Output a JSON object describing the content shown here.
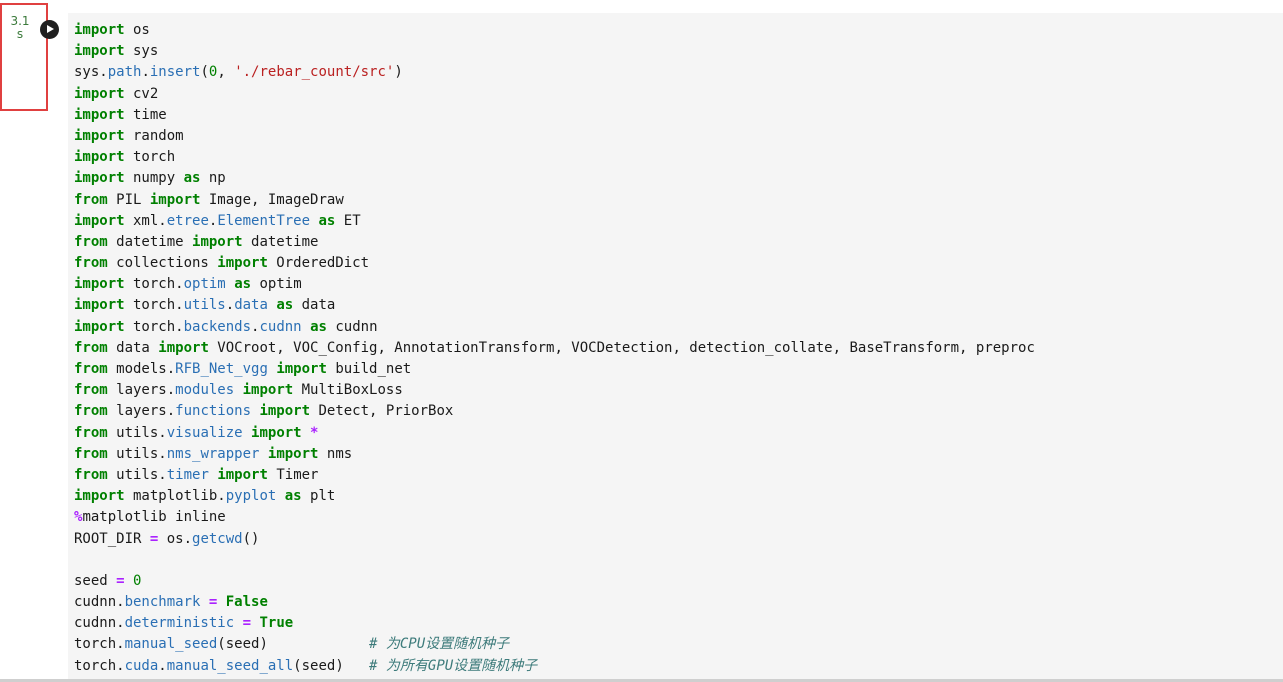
{
  "execution": {
    "time_label": "3.1 s"
  },
  "cell": {
    "lines": [
      [
        {
          "t": "import",
          "c": "kw"
        },
        {
          "t": " os",
          "c": ""
        }
      ],
      [
        {
          "t": "import",
          "c": "kw"
        },
        {
          "t": " sys",
          "c": ""
        }
      ],
      [
        {
          "t": "sys.",
          "c": ""
        },
        {
          "t": "path",
          "c": "attr"
        },
        {
          "t": ".",
          "c": ""
        },
        {
          "t": "insert",
          "c": "attr"
        },
        {
          "t": "(",
          "c": ""
        },
        {
          "t": "0",
          "c": "num"
        },
        {
          "t": ", ",
          "c": ""
        },
        {
          "t": "'./rebar_count/src'",
          "c": "str"
        },
        {
          "t": ")",
          "c": ""
        }
      ],
      [
        {
          "t": "import",
          "c": "kw"
        },
        {
          "t": " cv2",
          "c": ""
        }
      ],
      [
        {
          "t": "import",
          "c": "kw"
        },
        {
          "t": " time",
          "c": ""
        }
      ],
      [
        {
          "t": "import",
          "c": "kw"
        },
        {
          "t": " random",
          "c": ""
        }
      ],
      [
        {
          "t": "import",
          "c": "kw"
        },
        {
          "t": " torch",
          "c": ""
        }
      ],
      [
        {
          "t": "import",
          "c": "kw"
        },
        {
          "t": " numpy ",
          "c": ""
        },
        {
          "t": "as",
          "c": "kw"
        },
        {
          "t": " np",
          "c": ""
        }
      ],
      [
        {
          "t": "from",
          "c": "kw"
        },
        {
          "t": " PIL ",
          "c": ""
        },
        {
          "t": "import",
          "c": "kw"
        },
        {
          "t": " Image, ImageDraw",
          "c": ""
        }
      ],
      [
        {
          "t": "import",
          "c": "kw"
        },
        {
          "t": " xml.",
          "c": ""
        },
        {
          "t": "etree",
          "c": "attr"
        },
        {
          "t": ".",
          "c": ""
        },
        {
          "t": "ElementTree",
          "c": "attr"
        },
        {
          "t": " ",
          "c": ""
        },
        {
          "t": "as",
          "c": "kw"
        },
        {
          "t": " ET",
          "c": ""
        }
      ],
      [
        {
          "t": "from",
          "c": "kw"
        },
        {
          "t": " datetime ",
          "c": ""
        },
        {
          "t": "import",
          "c": "kw"
        },
        {
          "t": " datetime",
          "c": ""
        }
      ],
      [
        {
          "t": "from",
          "c": "kw"
        },
        {
          "t": " collections ",
          "c": ""
        },
        {
          "t": "import",
          "c": "kw"
        },
        {
          "t": " OrderedDict",
          "c": ""
        }
      ],
      [
        {
          "t": "import",
          "c": "kw"
        },
        {
          "t": " torch.",
          "c": ""
        },
        {
          "t": "optim",
          "c": "attr"
        },
        {
          "t": " ",
          "c": ""
        },
        {
          "t": "as",
          "c": "kw"
        },
        {
          "t": " optim",
          "c": ""
        }
      ],
      [
        {
          "t": "import",
          "c": "kw"
        },
        {
          "t": " torch.",
          "c": ""
        },
        {
          "t": "utils",
          "c": "attr"
        },
        {
          "t": ".",
          "c": ""
        },
        {
          "t": "data",
          "c": "attr"
        },
        {
          "t": " ",
          "c": ""
        },
        {
          "t": "as",
          "c": "kw"
        },
        {
          "t": " data",
          "c": ""
        }
      ],
      [
        {
          "t": "import",
          "c": "kw"
        },
        {
          "t": " torch.",
          "c": ""
        },
        {
          "t": "backends",
          "c": "attr"
        },
        {
          "t": ".",
          "c": ""
        },
        {
          "t": "cudnn",
          "c": "attr"
        },
        {
          "t": " ",
          "c": ""
        },
        {
          "t": "as",
          "c": "kw"
        },
        {
          "t": " cudnn",
          "c": ""
        }
      ],
      [
        {
          "t": "from",
          "c": "kw"
        },
        {
          "t": " data ",
          "c": ""
        },
        {
          "t": "import",
          "c": "kw"
        },
        {
          "t": " VOCroot, VOC_Config, AnnotationTransform, VOCDetection, detection_collate, BaseTransform, preproc",
          "c": ""
        }
      ],
      [
        {
          "t": "from",
          "c": "kw"
        },
        {
          "t": " models.",
          "c": ""
        },
        {
          "t": "RFB_Net_vgg",
          "c": "attr"
        },
        {
          "t": " ",
          "c": ""
        },
        {
          "t": "import",
          "c": "kw"
        },
        {
          "t": " build_net",
          "c": ""
        }
      ],
      [
        {
          "t": "from",
          "c": "kw"
        },
        {
          "t": " layers.",
          "c": ""
        },
        {
          "t": "modules",
          "c": "attr"
        },
        {
          "t": " ",
          "c": ""
        },
        {
          "t": "import",
          "c": "kw"
        },
        {
          "t": " MultiBoxLoss",
          "c": ""
        }
      ],
      [
        {
          "t": "from",
          "c": "kw"
        },
        {
          "t": " layers.",
          "c": ""
        },
        {
          "t": "functions",
          "c": "attr"
        },
        {
          "t": " ",
          "c": ""
        },
        {
          "t": "import",
          "c": "kw"
        },
        {
          "t": " Detect, PriorBox",
          "c": ""
        }
      ],
      [
        {
          "t": "from",
          "c": "kw"
        },
        {
          "t": " utils.",
          "c": ""
        },
        {
          "t": "visualize",
          "c": "attr"
        },
        {
          "t": " ",
          "c": ""
        },
        {
          "t": "import",
          "c": "kw"
        },
        {
          "t": " ",
          "c": ""
        },
        {
          "t": "*",
          "c": "op"
        }
      ],
      [
        {
          "t": "from",
          "c": "kw"
        },
        {
          "t": " utils.",
          "c": ""
        },
        {
          "t": "nms_wrapper",
          "c": "attr"
        },
        {
          "t": " ",
          "c": ""
        },
        {
          "t": "import",
          "c": "kw"
        },
        {
          "t": " nms",
          "c": ""
        }
      ],
      [
        {
          "t": "from",
          "c": "kw"
        },
        {
          "t": " utils.",
          "c": ""
        },
        {
          "t": "timer",
          "c": "attr"
        },
        {
          "t": " ",
          "c": ""
        },
        {
          "t": "import",
          "c": "kw"
        },
        {
          "t": " Timer",
          "c": ""
        }
      ],
      [
        {
          "t": "import",
          "c": "kw"
        },
        {
          "t": " matplotlib.",
          "c": ""
        },
        {
          "t": "pyplot",
          "c": "attr"
        },
        {
          "t": " ",
          "c": ""
        },
        {
          "t": "as",
          "c": "kw"
        },
        {
          "t": " plt",
          "c": ""
        }
      ],
      [
        {
          "t": "%",
          "c": "op"
        },
        {
          "t": "matplotlib inline",
          "c": ""
        }
      ],
      [
        {
          "t": "ROOT_DIR ",
          "c": ""
        },
        {
          "t": "=",
          "c": "op"
        },
        {
          "t": " os.",
          "c": ""
        },
        {
          "t": "getcwd",
          "c": "attr"
        },
        {
          "t": "()",
          "c": ""
        }
      ],
      [],
      [
        {
          "t": "seed ",
          "c": ""
        },
        {
          "t": "=",
          "c": "op"
        },
        {
          "t": " ",
          "c": ""
        },
        {
          "t": "0",
          "c": "num"
        }
      ],
      [
        {
          "t": "cudnn.",
          "c": ""
        },
        {
          "t": "benchmark",
          "c": "attr"
        },
        {
          "t": " ",
          "c": ""
        },
        {
          "t": "=",
          "c": "op"
        },
        {
          "t": " ",
          "c": ""
        },
        {
          "t": "False",
          "c": "kw"
        }
      ],
      [
        {
          "t": "cudnn.",
          "c": ""
        },
        {
          "t": "deterministic",
          "c": "attr"
        },
        {
          "t": " ",
          "c": ""
        },
        {
          "t": "=",
          "c": "op"
        },
        {
          "t": " ",
          "c": ""
        },
        {
          "t": "True",
          "c": "kw"
        }
      ],
      [
        {
          "t": "torch.",
          "c": ""
        },
        {
          "t": "manual_seed",
          "c": "attr"
        },
        {
          "t": "(seed)            ",
          "c": ""
        },
        {
          "t": "# 为CPU设置随机种子",
          "c": "cmt"
        }
      ],
      [
        {
          "t": "torch.",
          "c": ""
        },
        {
          "t": "cuda",
          "c": "attr"
        },
        {
          "t": ".",
          "c": ""
        },
        {
          "t": "manual_seed_all",
          "c": "attr"
        },
        {
          "t": "(seed)   ",
          "c": ""
        },
        {
          "t": "# 为所有GPU设置随机种子",
          "c": "cmt"
        }
      ]
    ]
  }
}
